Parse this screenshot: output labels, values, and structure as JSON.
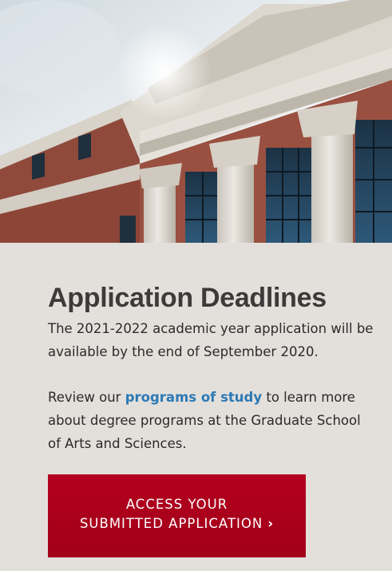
{
  "hero": {
    "icon": "building-columns-photo"
  },
  "card": {
    "title": "Application Deadlines",
    "para1": "The 2021-2022 academic year application will be available by the end of September 2020.",
    "para2_pre": "Review our ",
    "para2_link": "programs of study",
    "para2_post": " to learn more about degree programs at the Graduate School of Arts and Sciences.",
    "cta_line1": "ACCESS YOUR",
    "cta_line2": "SUBMITTED APPLICATION",
    "cta_icon": "chevron-right-icon"
  },
  "colors": {
    "accent": "#a50021",
    "link": "#2d79b5",
    "background": "#e3e0dc",
    "heading": "#3d3b3a"
  }
}
